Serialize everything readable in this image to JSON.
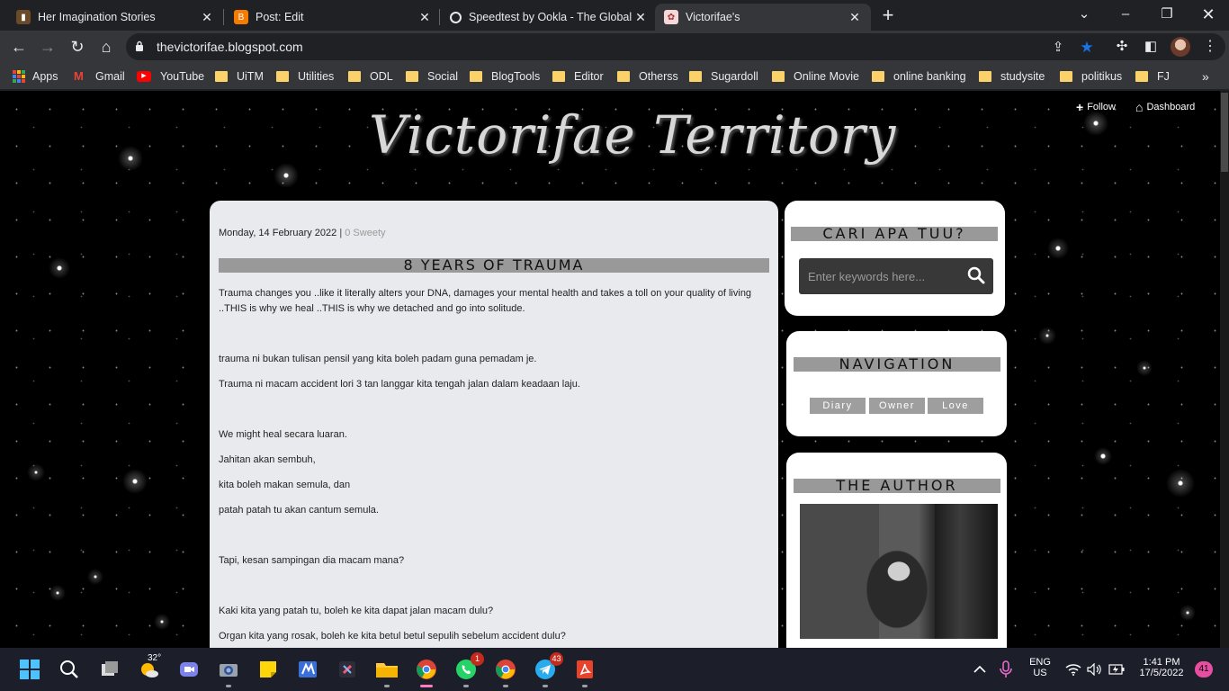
{
  "browser": {
    "tabs": [
      {
        "title": "Her Imagination Stories",
        "favicon": "book-icon",
        "active": false
      },
      {
        "title": "Post: Edit",
        "favicon": "blogger-icon",
        "active": false
      },
      {
        "title": "Speedtest by Ookla - The Global",
        "favicon": "speedtest-icon",
        "active": false
      },
      {
        "title": "Victorifae's",
        "favicon": "blog-favicon",
        "active": true
      }
    ],
    "url": "thevictorifae.blogspot.com",
    "bookmarks": [
      {
        "label": "Apps",
        "icon": "apps-icon"
      },
      {
        "label": "Gmail",
        "icon": "gmail-icon"
      },
      {
        "label": "YouTube",
        "icon": "youtube-icon"
      },
      {
        "label": "UiTM",
        "icon": "folder-icon"
      },
      {
        "label": "Utilities",
        "icon": "folder-icon"
      },
      {
        "label": "ODL",
        "icon": "folder-icon"
      },
      {
        "label": "Social",
        "icon": "folder-icon"
      },
      {
        "label": "BlogTools",
        "icon": "folder-icon"
      },
      {
        "label": "Editor",
        "icon": "folder-icon"
      },
      {
        "label": "Otherss",
        "icon": "folder-icon"
      },
      {
        "label": "Sugardoll",
        "icon": "folder-icon"
      },
      {
        "label": "Online Movie",
        "icon": "folder-icon"
      },
      {
        "label": "online banking",
        "icon": "folder-icon"
      },
      {
        "label": "studysite",
        "icon": "folder-icon"
      },
      {
        "label": "politikus",
        "icon": "folder-icon"
      },
      {
        "label": "FJ",
        "icon": "folder-icon"
      }
    ]
  },
  "blog": {
    "title": "Victorifae Territory",
    "navbar": {
      "follow": "Follow",
      "dashboard": "Dashboard"
    },
    "post": {
      "date": "Monday, 14 February 2022",
      "separator": "|",
      "comments": "0 Sweety",
      "title": "8 YEARS OF TRAUMA",
      "paragraphs": [
        "Trauma changes you ..like it literally alters your DNA, damages your mental health and takes a toll on your quality of living ..THIS is why we heal ..THIS is why we detached and go into solitude.",
        "trauma ni bukan tulisan pensil yang kita boleh padam guna pemadam je.",
        "Trauma ni macam accident lori 3 tan langgar kita tengah jalan dalam keadaan laju.",
        "We might heal secara luaran.",
        "Jahitan akan sembuh,",
        "kita boleh makan semula, dan",
        "patah patah tu akan cantum semula.",
        "Tapi, kesan sampingan dia macam mana?",
        "Kaki kita yang patah tu, boleh ke kita dapat jalan macam dulu?",
        "Organ kita yang rosak, boleh ke kita betul betul sepulih sebelum accident dulu?"
      ]
    },
    "sidebar": {
      "search": {
        "heading": "CARI APA TUU?",
        "placeholder": "Enter keywords here..."
      },
      "navigation": {
        "heading": "NAVIGATION",
        "links": [
          "Diary",
          "Owner",
          "Love"
        ]
      },
      "author": {
        "heading": "THE AUTHOR"
      }
    }
  },
  "taskbar": {
    "weather": "32°",
    "whatsapp_badge": "1",
    "telegram_badge": "43",
    "language": "ENG",
    "region": "US",
    "time": "1:41 PM",
    "date": "17/5/2022",
    "notifications": "41"
  },
  "colors": {
    "accent_star": "#1a73e8",
    "folder": "#fbd26a",
    "heading_bar": "#999999"
  }
}
